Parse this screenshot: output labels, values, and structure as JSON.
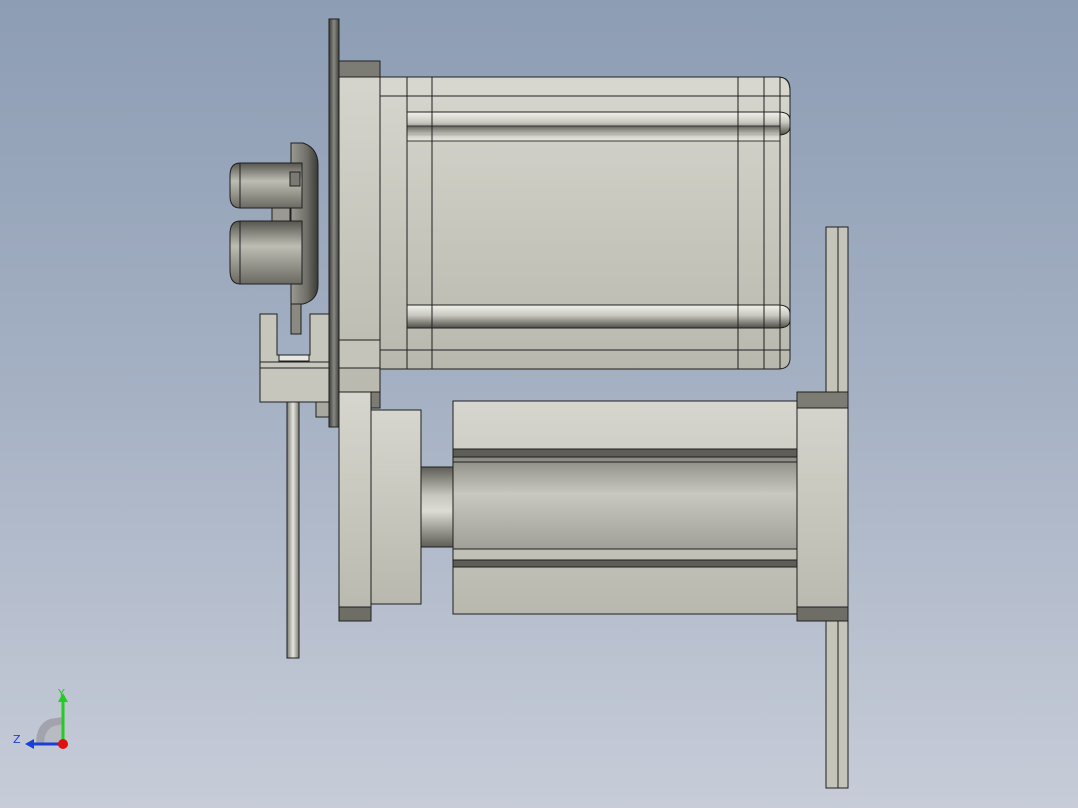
{
  "viewport": {
    "background_top": "#8d9db4",
    "background_bottom": "#c7ccd8"
  },
  "model": {
    "body_color": "#c0c0b6",
    "dark_band_color": "#6e6e66",
    "edge_color": "#1f1f1f"
  },
  "triad": {
    "y_label": "Y",
    "z_label": "Z",
    "y_color": "#22cc22",
    "z_color": "#1a3fd6",
    "x_color": "#e01010"
  }
}
